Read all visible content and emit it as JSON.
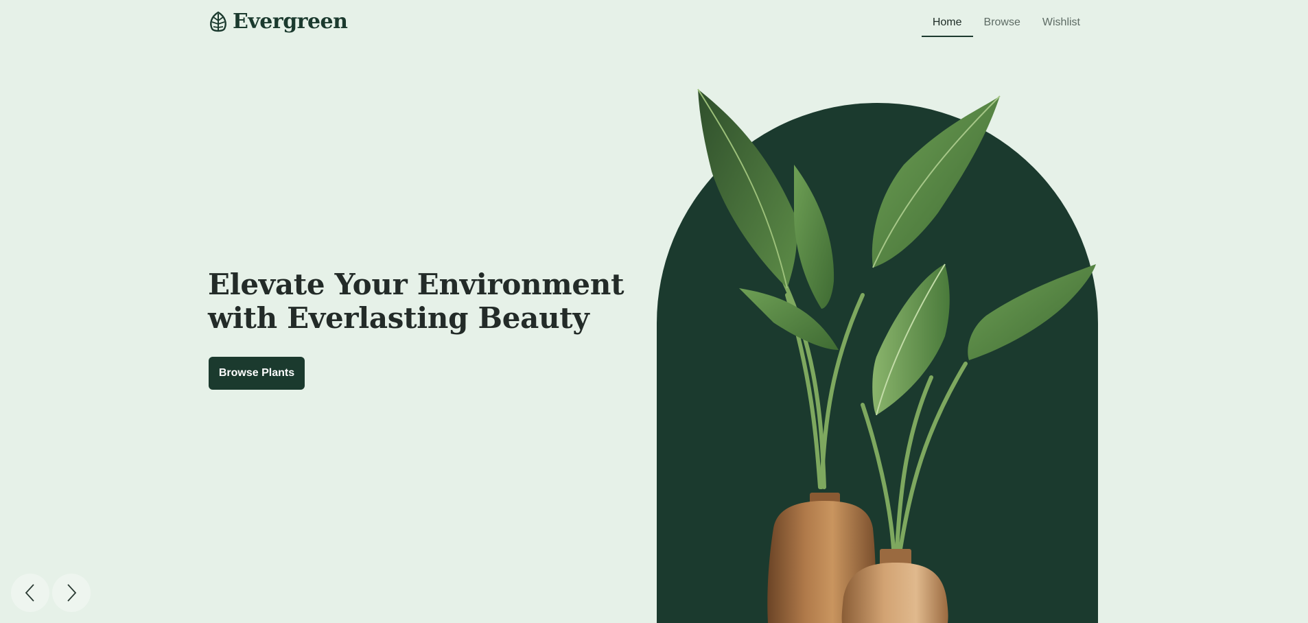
{
  "brand": {
    "name": "Evergreen",
    "icon": "leaf-icon"
  },
  "nav": {
    "items": [
      {
        "label": "Home",
        "active": true
      },
      {
        "label": "Browse",
        "active": false
      },
      {
        "label": "Wishlist",
        "active": false
      }
    ]
  },
  "hero": {
    "title_line1": "Elevate Your Environment",
    "title_line2": "with Everlasting Beauty",
    "cta_label": "Browse Plants",
    "image": "potted-plant-illustration"
  },
  "carousel": {
    "prev_icon": "chevron-left-icon",
    "next_icon": "chevron-right-icon"
  },
  "colors": {
    "background": "#e6f1e8",
    "primary": "#1b3a2e",
    "text": "#232b28",
    "muted": "#5d6b64"
  }
}
